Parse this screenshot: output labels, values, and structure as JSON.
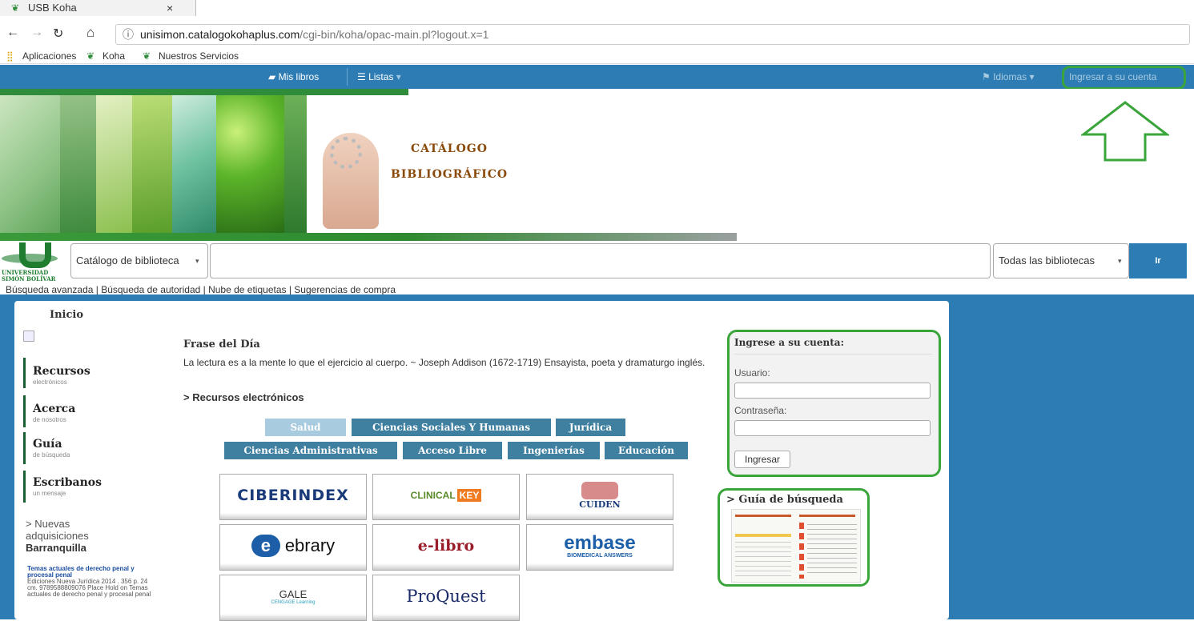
{
  "browser": {
    "tab_title": "USB Koha",
    "tab_close": "×",
    "url_host": "unisimon.catalogokohaplus.com",
    "url_path": "/cgi-bin/koha/opac-main.pl?logout.x=1"
  },
  "bookmarks": [
    "Aplicaciones",
    "Koha",
    "Nuestros Servicios"
  ],
  "navbar": {
    "mis_libros": "Mis libros",
    "listas": "Listas",
    "idiomas": "Idiomas",
    "ingresar": "Ingresar a su cuenta"
  },
  "banner": {
    "line1": "CATÁLOGO",
    "line2": "BIBLIOGRÁFICO"
  },
  "logo": {
    "line1": "UNIVERSIDAD",
    "line2": "SIMÓN BOLÍVAR"
  },
  "search": {
    "catalog_select": "Catálogo de biblioteca",
    "library_select": "Todas las bibliotecas",
    "go": "Ir"
  },
  "links": "Búsqueda avanzada | Búsqueda de autoridad | Nube de etiquetas | Sugerencias de compra",
  "sidebar": {
    "inicio": "Inicio",
    "items": [
      {
        "title": "Recursos",
        "sub": "electrónicos"
      },
      {
        "title": "Acerca",
        "sub": "de nosotros"
      },
      {
        "title": "Guía",
        "sub": "de búsqueda"
      },
      {
        "title": "Escribanos",
        "sub": "un mensaje"
      }
    ],
    "nuevas_prefix": "> Nuevas",
    "nuevas_2": "adquisiciones",
    "nuevas_3": "Barranquilla",
    "book_title": "Temas actuales de derecho penal y procesal penal",
    "book_text": "Ediciones Nueva Jurídica 2014 . 356 p. 24 cm. 9789588809076 Place Hold on Temas actuales de derecho penal y procesal penal"
  },
  "main": {
    "frase_title": "Frase del Día",
    "frase_text": "La lectura es a la mente lo que el ejercicio al cuerpo. ~ Joseph Addison (1672-1719) Ensayista, poeta y dramaturgo inglés.",
    "recursos": "> Recursos electrónicos",
    "tags_row1": [
      "Salud",
      "Ciencias Sociales Y Humanas",
      "Jurídica"
    ],
    "tags_row2": [
      "Ciencias Administrativas",
      "Acceso Libre",
      "Ingenierías",
      "Educación"
    ],
    "tiles": [
      "CIBERINDEX",
      "CLINICAL KEY",
      "CUIDEN",
      "ebrary",
      "e-libro",
      "embase",
      "GALE",
      "ProQuest"
    ],
    "clinical_1": "CLINICAL",
    "clinical_2": "KEY",
    "embase_sub": "BIOMEDICAL ANSWERS",
    "gale_sub": "CENGAGE Learning"
  },
  "login": {
    "title": "Ingrese a su cuenta:",
    "user_label": "Usuario:",
    "pass_label": "Contraseña:",
    "button": "Ingresar"
  },
  "guide": {
    "title": "> Guía de búsqueda"
  },
  "colors": {
    "navbar": "#2e7cb4",
    "highlight": "#3aa53a",
    "tag": "#3f7fa0",
    "tag_active": "#a9cbe0"
  }
}
